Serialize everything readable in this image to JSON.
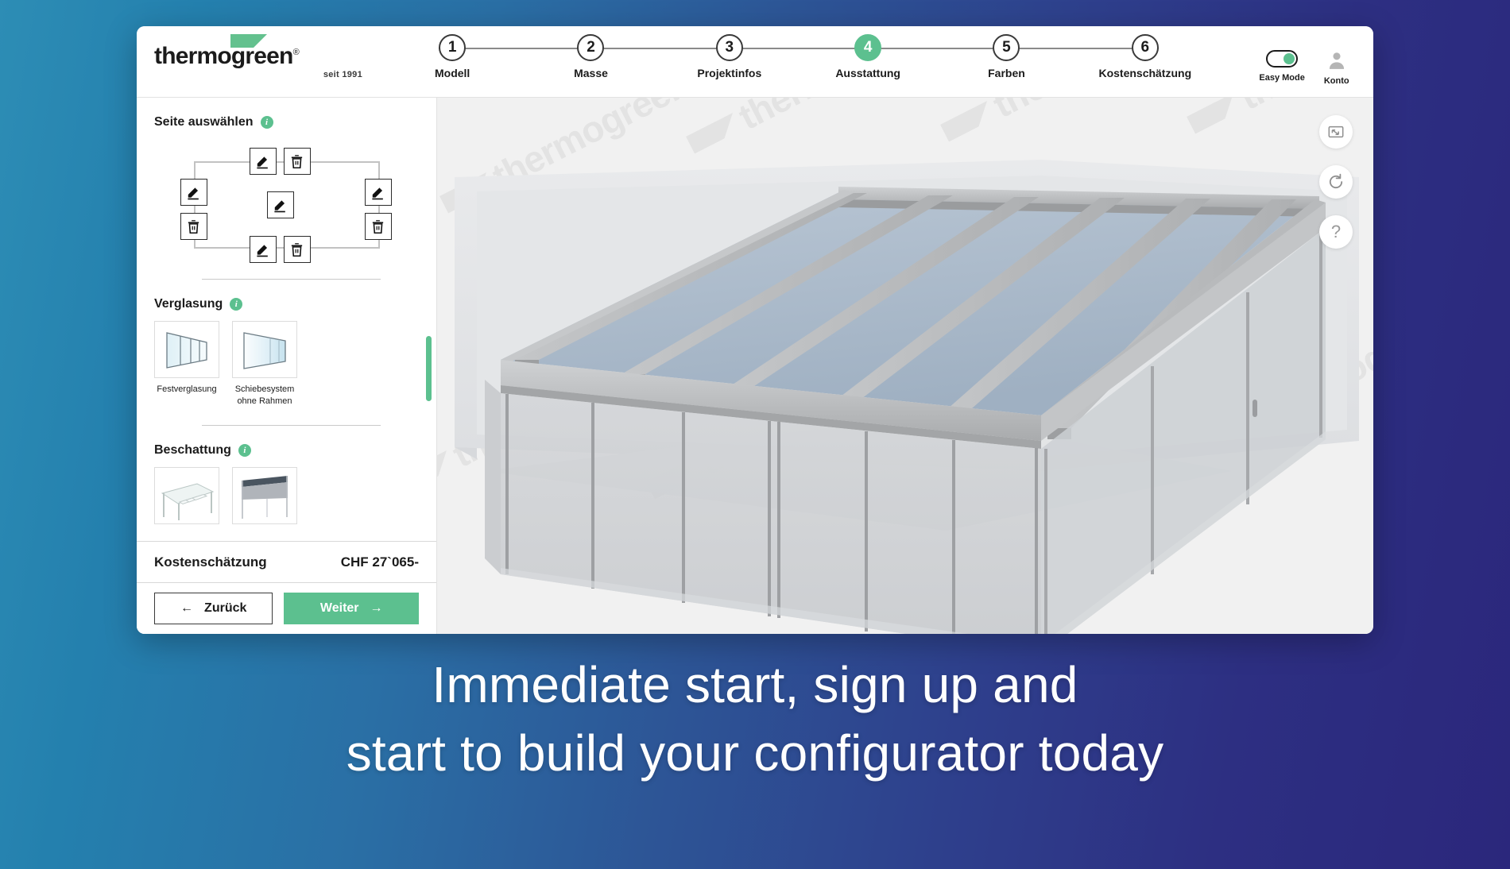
{
  "brand": {
    "wordmark": "thermogreen",
    "registered": "®",
    "tagline": "seit 1991",
    "logo_mark": "triangle-swoosh-icon",
    "accent_green": "#5cc08f",
    "dark": "#1b1b1b"
  },
  "header": {
    "steps": [
      {
        "number": "1",
        "label": "Modell",
        "active": false
      },
      {
        "number": "2",
        "label": "Masse",
        "active": false
      },
      {
        "number": "3",
        "label": "Projektinfos",
        "active": false
      },
      {
        "number": "4",
        "label": "Ausstattung",
        "active": true
      },
      {
        "number": "5",
        "label": "Farben",
        "active": false
      },
      {
        "number": "6",
        "label": "Kostenschätzung",
        "active": false
      }
    ],
    "easy_mode": {
      "label": "Easy Mode",
      "state": "on"
    },
    "account": {
      "label": "Konto",
      "icon": "user-avatar-icon"
    }
  },
  "sidebar": {
    "sections": [
      {
        "title": "Seite auswählen",
        "info": "info-icon",
        "type": "side-selector",
        "side_buttons": [
          {
            "side": "top",
            "action": "edit"
          },
          {
            "side": "top",
            "action": "delete"
          },
          {
            "side": "left",
            "action": "edit"
          },
          {
            "side": "left",
            "action": "delete"
          },
          {
            "side": "right",
            "action": "edit"
          },
          {
            "side": "right",
            "action": "delete"
          },
          {
            "side": "bottom",
            "action": "edit"
          },
          {
            "side": "bottom",
            "action": "delete"
          },
          {
            "side": "center",
            "action": "edit"
          }
        ]
      },
      {
        "title": "Verglasung",
        "info": "info-icon",
        "type": "thumbs",
        "options": [
          {
            "label": "Festverglasung",
            "thumb": "fixed-glazing-thumb"
          },
          {
            "label": "Schiebesystem\nohne Rahmen",
            "thumb": "frameless-sliding-thumb"
          }
        ]
      },
      {
        "title": "Beschattung",
        "info": "info-icon",
        "type": "thumbs",
        "options": [
          {
            "label": "",
            "thumb": "pergola-louvre-thumb"
          },
          {
            "label": "",
            "thumb": "awning-thumb"
          }
        ]
      }
    ],
    "scrollbar": {
      "color": "#5cc08f"
    }
  },
  "price_bar": {
    "label": "Kostenschätzung",
    "value": "CHF 27`065-"
  },
  "nav": {
    "back_label": "Zurück",
    "back_arrow": "←",
    "next_label": "Weiter",
    "next_arrow": "→"
  },
  "viewport": {
    "watermark_text": "thermogreen",
    "buttons": [
      {
        "name": "fullscreen",
        "icon": "expand-arrows-icon"
      },
      {
        "name": "reset-view",
        "icon": "refresh-icon"
      },
      {
        "name": "help",
        "icon": "question-mark-icon",
        "glyph": "?"
      }
    ],
    "model": "glass-conservatory-3d"
  },
  "caption": {
    "line1": "Immediate start, sign up and",
    "line2": "start to build your configurator today"
  }
}
